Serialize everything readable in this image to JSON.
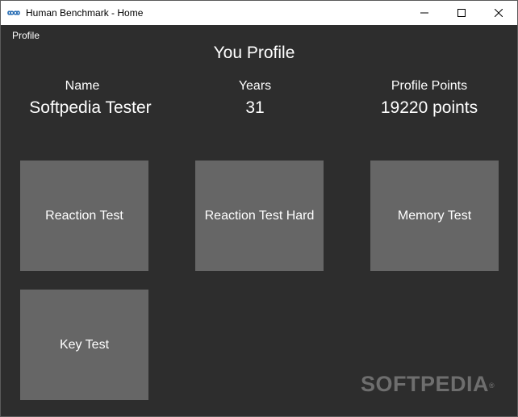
{
  "window": {
    "title": "Human Benchmark - Home"
  },
  "menu": {
    "profile_label": "Profile"
  },
  "page": {
    "title": "You Profile"
  },
  "profile": {
    "name_label": "Name",
    "name_value": "Softpedia Tester",
    "years_label": "Years",
    "years_value": "31",
    "points_label": "Profile Points",
    "points_value": "19220 points"
  },
  "tests": [
    {
      "label": "Reaction Test"
    },
    {
      "label": "Reaction Test Hard"
    },
    {
      "label": "Memory Test"
    },
    {
      "label": "Key Test"
    }
  ],
  "icons": {
    "app": "infinity-icon",
    "minimize": "minimize-icon",
    "maximize": "maximize-icon",
    "close": "close-icon"
  },
  "colors": {
    "background": "#2d2d2d",
    "tile": "#666666",
    "text": "#ffffff",
    "titlebar": "#ffffff"
  },
  "watermark": {
    "text": "SOFTPEDIA",
    "mark": "®"
  }
}
